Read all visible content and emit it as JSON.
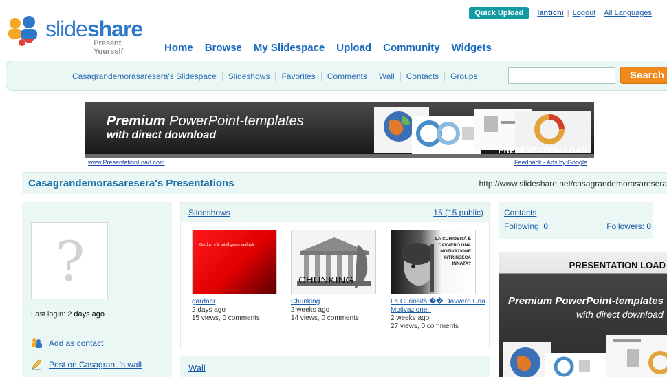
{
  "brand": {
    "name_slide": "slide",
    "name_share": "share",
    "tagline": "Present Yourself"
  },
  "topbar": {
    "quick_upload": "Quick Upload",
    "username": "lantichi",
    "logout": "Logout",
    "languages": "All Languages"
  },
  "mainnav": [
    "Home",
    "Browse",
    "My Slidespace",
    "Upload",
    "Community",
    "Widgets"
  ],
  "subnav": {
    "links": [
      "Casagrandemorasaresera's Slidespace",
      "Slideshows",
      "Favorites",
      "Comments",
      "Wall",
      "Contacts",
      "Groups"
    ],
    "search_button": "Search",
    "search_placeholder": ""
  },
  "banner_ad": {
    "headline_bold": "Premium",
    "headline_rest": " PowerPoint-templates",
    "subline": "with direct download",
    "brand": "PRESENTATION LOAD",
    "url": "www.PresentationLoad.com",
    "feedback": "Feedback - Ads by Google"
  },
  "page": {
    "title": "Casagrandemorasaresera's Presentations",
    "url": "http://www.slideshare.net/casagrandemorasaresera"
  },
  "profile": {
    "last_login_label": "Last login: ",
    "last_login_value": "2 days ago",
    "actions": [
      "Add as contact",
      "Post on Casagran..'s wall"
    ]
  },
  "slideshows": {
    "title": "Slideshows",
    "count": "15 (15 public)",
    "items": [
      {
        "title": "gardner",
        "age": "2 days ago",
        "stats": "15 views, 0 comments",
        "thumb_text": "Gardner e le intelligenze multiple"
      },
      {
        "title": "Chunking",
        "age": "2 weeks ago",
        "stats": "14 views, 0 comments",
        "thumb_text": "CHUNKING"
      },
      {
        "title": "La Curiosità �� Davvero Una Motivazione..",
        "age": "2 weeks ago",
        "stats": "27 views, 0 comments",
        "thumb_text": "LA CURIOSITÀ È DAVVERO UNA MOTIVAZIONE INTRINSECA INNATA?"
      }
    ]
  },
  "wall": {
    "title": "Wall"
  },
  "contacts": {
    "title": "Contacts",
    "following_label": "Following: ",
    "following_value": "0",
    "followers_label": "Followers: ",
    "followers_value": "0"
  },
  "side_ad": {
    "brand": "PRESENTATION LOAD",
    "headline": "Premium PowerPoint-templates",
    "subline": "with direct download"
  },
  "colors": {
    "accent_blue": "#1a6abf",
    "panel_bg": "#eaf7f5",
    "search_orange": "#f08a1c",
    "quick_upload_teal": "#139ba3"
  }
}
